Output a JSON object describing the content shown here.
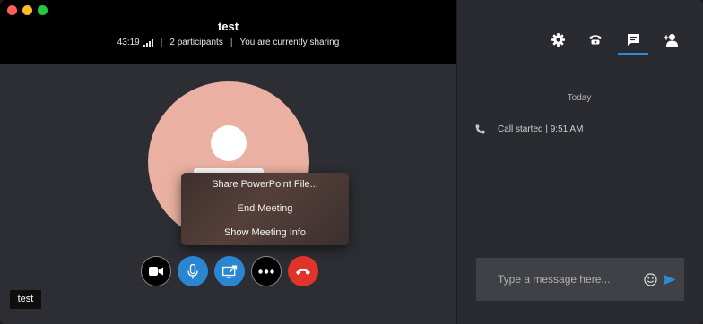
{
  "window": {
    "controls": [
      "close",
      "minimize",
      "zoom"
    ]
  },
  "meeting": {
    "title": "test",
    "duration": "43:19",
    "participants": "2 participants",
    "sharing_status": "You are currently sharing",
    "separator": "|"
  },
  "menu": {
    "items": [
      {
        "label": "Share PowerPoint File..."
      },
      {
        "label": "End Meeting"
      },
      {
        "label": "Show Meeting Info"
      }
    ]
  },
  "controls": [
    {
      "icon": "video-camera-icon"
    },
    {
      "icon": "microphone-icon"
    },
    {
      "icon": "share-screen-icon"
    },
    {
      "icon": "more-options-icon"
    },
    {
      "icon": "hang-up-icon"
    }
  ],
  "self_view": {
    "label": "test"
  },
  "chat_panel": {
    "tabs": [
      {
        "icon": "gear-icon"
      },
      {
        "icon": "phone-icon"
      },
      {
        "icon": "chat-icon",
        "active": true
      },
      {
        "icon": "add-person-icon"
      }
    ],
    "day_separator": "Today",
    "events": [
      {
        "icon": "phone-handset-icon",
        "text": "Call started | 9:51 AM"
      }
    ],
    "composer": {
      "placeholder": "Type a message here..."
    }
  },
  "colors": {
    "accent": "#2f8ad6",
    "hangup": "#e03329",
    "avatar": "#eab0a1"
  }
}
